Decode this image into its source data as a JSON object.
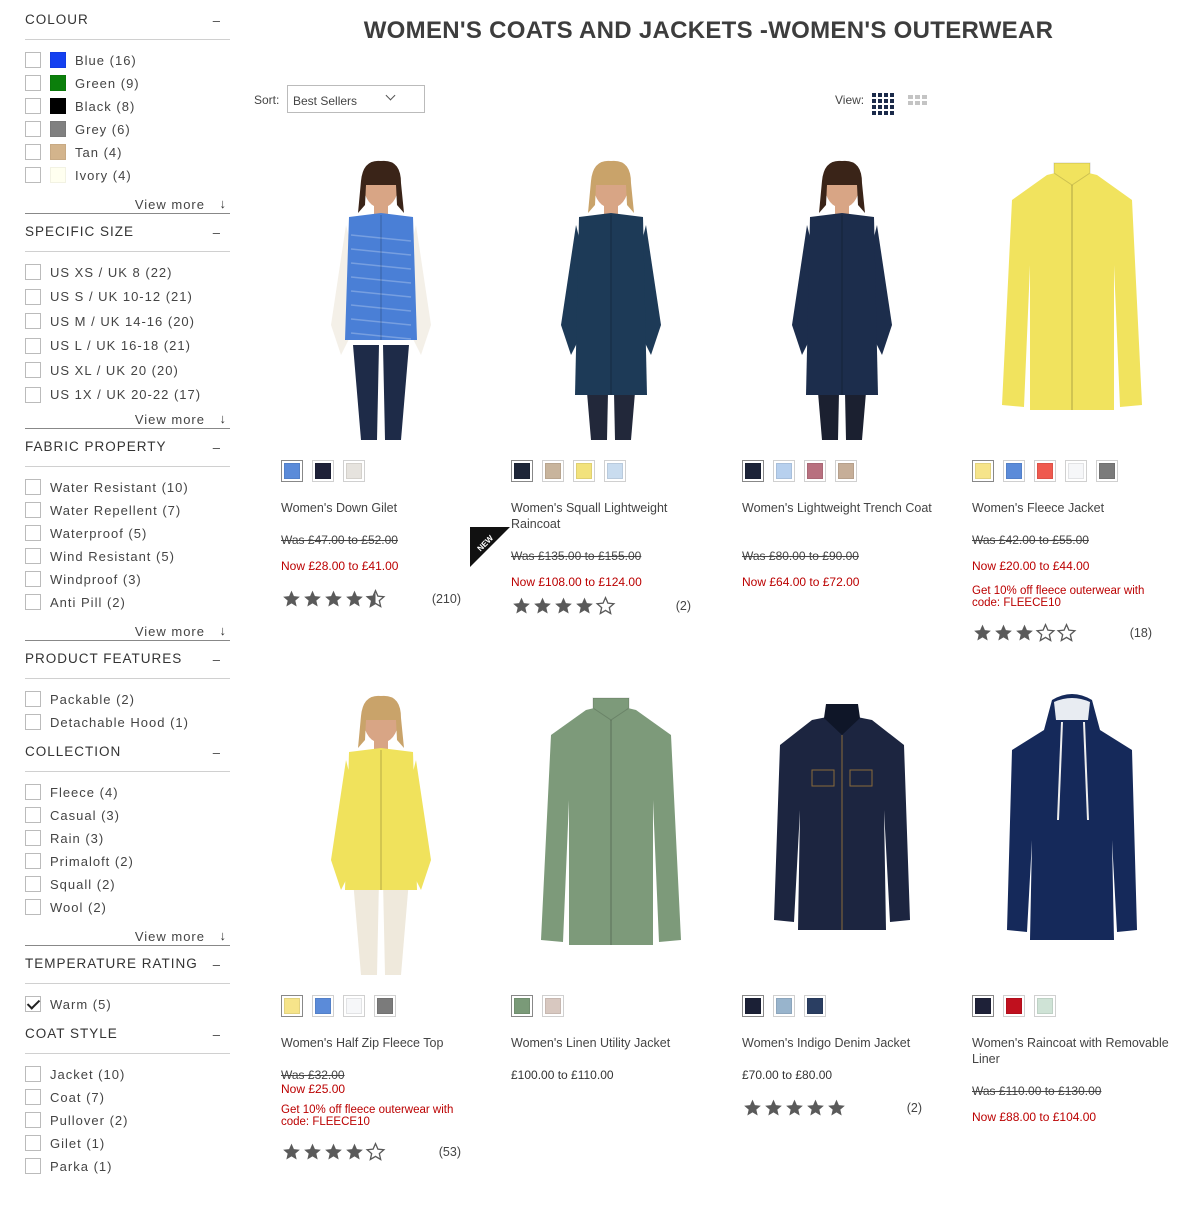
{
  "page": {
    "title": "WOMEN'S COATS AND JACKETS -WOMEN'S OUTERWEAR"
  },
  "toolbar": {
    "sort_label": "Sort:",
    "sort_value": "Best Sellers",
    "view_label": "View:"
  },
  "filters": [
    {
      "title": "COLOUR",
      "toggle": "–",
      "options": [
        {
          "label": "Blue (16)",
          "swatch": "#1440f0",
          "checked": false
        },
        {
          "label": "Green (9)",
          "swatch": "#0b7f0b",
          "checked": false
        },
        {
          "label": "Black (8)",
          "swatch": "#000000",
          "checked": false
        },
        {
          "label": "Grey (6)",
          "swatch": "#808080",
          "checked": false
        },
        {
          "label": "Tan (4)",
          "swatch": "#d3b48c",
          "checked": false
        },
        {
          "label": "Ivory (4)",
          "swatch": "#fffff0",
          "checked": false
        }
      ],
      "view_more": "View more"
    },
    {
      "title": "SPECIFIC SIZE",
      "toggle": "–",
      "options": [
        {
          "label": "US XS / UK 8 (22)",
          "checked": false
        },
        {
          "label": "US S / UK 10-12 (21)",
          "checked": false
        },
        {
          "label": "US M / UK 14-16 (20)",
          "checked": false
        },
        {
          "label": "US L / UK 16-18 (21)",
          "checked": false
        },
        {
          "label": "US XL / UK 20 (20)",
          "checked": false
        },
        {
          "label": "US 1X / UK 20-22 (17)",
          "checked": false
        }
      ],
      "view_more": "View more"
    },
    {
      "title": "FABRIC PROPERTY",
      "toggle": "–",
      "options": [
        {
          "label": "Water Resistant (10)",
          "checked": false
        },
        {
          "label": "Water Repellent (7)",
          "checked": false
        },
        {
          "label": "Waterproof (5)",
          "checked": false
        },
        {
          "label": "Wind Resistant (5)",
          "checked": false
        },
        {
          "label": "Windproof (3)",
          "checked": false
        },
        {
          "label": "Anti Pill (2)",
          "checked": false
        }
      ],
      "view_more": "View more"
    },
    {
      "title": "PRODUCT FEATURES",
      "toggle": "–",
      "options": [
        {
          "label": "Packable (2)",
          "checked": false
        },
        {
          "label": "Detachable Hood (1)",
          "checked": false
        }
      ],
      "view_more": ""
    },
    {
      "title": "COLLECTION",
      "toggle": "–",
      "options": [
        {
          "label": "Fleece (4)",
          "checked": false
        },
        {
          "label": "Casual (3)",
          "checked": false
        },
        {
          "label": "Rain (3)",
          "checked": false
        },
        {
          "label": "Primaloft (2)",
          "checked": false
        },
        {
          "label": "Squall (2)",
          "checked": false
        },
        {
          "label": "Wool (2)",
          "checked": false
        }
      ],
      "view_more": "View more"
    },
    {
      "title": "TEMPERATURE RATING",
      "toggle": "–",
      "options": [
        {
          "label": "Warm (5)",
          "checked": true
        }
      ],
      "view_more": ""
    },
    {
      "title": "COAT STYLE",
      "toggle": "–",
      "options": [
        {
          "label": "Jacket (10)",
          "checked": false
        },
        {
          "label": "Coat (7)",
          "checked": false
        },
        {
          "label": "Pullover (2)",
          "checked": false
        },
        {
          "label": "Gilet (1)",
          "checked": false
        },
        {
          "label": "Parka (1)",
          "checked": false
        }
      ],
      "view_more": ""
    }
  ],
  "products": [
    {
      "name": "Women's Down Gilet",
      "was": "Was £47.00 to £52.00",
      "now": "Now £28.00 to £41.00",
      "price": "",
      "promo": "",
      "rating": 4.5,
      "reviews": "(210)",
      "badge": "",
      "kind": "gilet",
      "garment": "#4a7fd6",
      "sleeve": "#f4f0e8",
      "pants": "#1e2b48",
      "swatches": [
        "#5b8bd9",
        "#1e2138",
        "#e6e3de"
      ]
    },
    {
      "name": "Women's Squall Lightweight Raincoat",
      "was": "Was £135.00 to £155.00",
      "now": "Now £108.00 to £124.00",
      "price": "",
      "promo": "",
      "rating": 4,
      "reviews": "(2)",
      "badge": "",
      "kind": "coat",
      "garment": "#1d3a57",
      "sleeve": "#1d3a57",
      "pants": "#22283a",
      "swatches": [
        "#1e2638",
        "#c8b49c",
        "#f2e27c",
        "#c9dcef"
      ]
    },
    {
      "name": "Women's Lightweight Trench Coat",
      "was": "Was £80.00 to £90.00",
      "now": "Now £64.00 to £72.00",
      "price": "",
      "promo": "",
      "rating": 0,
      "reviews": "",
      "badge": "",
      "kind": "coat",
      "garment": "#1c2d4c",
      "sleeve": "#1c2d4c",
      "pants": "#1b2030",
      "swatches": [
        "#1c2338",
        "#b7d0ee",
        "#b8707f",
        "#c6ae98"
      ]
    },
    {
      "name": "Women's Fleece Jacket",
      "was": "Was £42.00 to £55.00",
      "now": "Now £20.00 to £44.00",
      "price": "",
      "promo": "Get 10% off fleece outerwear with code: FLEECE10",
      "rating": 3,
      "reviews": "(18)",
      "badge": "",
      "kind": "flat",
      "garment": "#f1e35e",
      "sleeve": "#f1e35e",
      "pants": "",
      "swatches": [
        "#f6e48a",
        "#5b8bd9",
        "#ef5a4f",
        "#f6f7f9",
        "#7b7b7b"
      ]
    },
    {
      "name": "Women's Half Zip Fleece Top",
      "was": "Was £32.00",
      "now": "Now £25.00",
      "price": "",
      "promo": "Get 10% off fleece outerwear with code: FLEECE10",
      "rating": 4,
      "reviews": "(53)",
      "badge": "",
      "kind": "top",
      "garment": "#f0e25c",
      "sleeve": "#f0e25c",
      "pants": "#efe9dc",
      "swatches": [
        "#f6e48a",
        "#5b8bd9",
        "#f6f7f9",
        "#7b7b7b"
      ]
    },
    {
      "name": "Women's Linen Utility Jacket",
      "was": "",
      "now": "",
      "price": "£100.00 to £110.00",
      "promo": "",
      "rating": 0,
      "reviews": "",
      "badge": "NEW",
      "kind": "flat",
      "garment": "#7d9a7a",
      "sleeve": "#7d9a7a",
      "pants": "",
      "swatches": [
        "#7a9a78",
        "#d8c8c0"
      ]
    },
    {
      "name": "Women's Indigo Denim Jacket",
      "was": "",
      "now": "",
      "price": "£70.00 to £80.00",
      "promo": "",
      "rating": 5,
      "reviews": "(2)",
      "badge": "",
      "kind": "denim",
      "garment": "#1c2540",
      "sleeve": "#1c2540",
      "pants": "",
      "swatches": [
        "#1b2036",
        "#98b4cc",
        "#2a3e62"
      ]
    },
    {
      "name": "Women's Raincoat with Removable Liner",
      "was": "Was £110.00 to £130.00",
      "now": "Now £88.00 to £104.00",
      "price": "",
      "promo": "",
      "rating": 0,
      "reviews": "",
      "badge": "",
      "kind": "rain",
      "garment": "#15295a",
      "sleeve": "#15295a",
      "pants": "",
      "swatches": [
        "#1e2138",
        "#c0101e",
        "#cfe3d6"
      ]
    }
  ],
  "colors": {
    "accent_red": "#b00000",
    "view_selected": "#1b2a4a",
    "view_unselected": "#c4c4c4"
  }
}
